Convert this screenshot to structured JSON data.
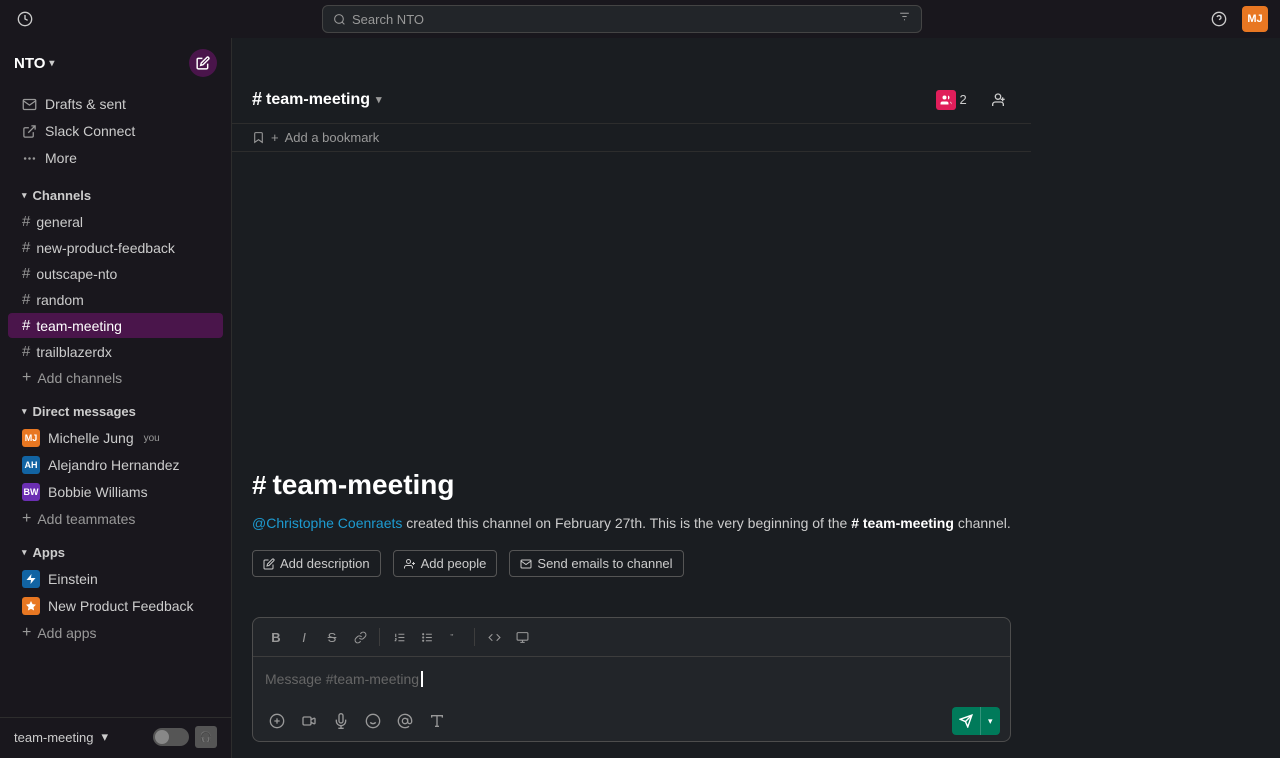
{
  "workspace": {
    "name": "NTO",
    "chevron": "▾"
  },
  "topbar": {
    "search_placeholder": "Search NTO",
    "filter_icon": "⚙",
    "history_icon": "🕐",
    "help_icon": "?",
    "avatar_initials": "MJ"
  },
  "sidebar": {
    "nav_items": [
      {
        "label": "Drafts & sent",
        "icon": "✉"
      },
      {
        "label": "Slack Connect",
        "icon": "⚡"
      },
      {
        "label": "More",
        "icon": "•••"
      }
    ],
    "channels_section": {
      "label": "Channels",
      "items": [
        {
          "label": "general",
          "active": false
        },
        {
          "label": "new-product-feedback",
          "active": false
        },
        {
          "label": "outscape-nto",
          "active": false
        },
        {
          "label": "random",
          "active": false
        },
        {
          "label": "team-meeting",
          "active": true
        },
        {
          "label": "trailblazerdx",
          "active": false
        }
      ],
      "add_label": "Add channels"
    },
    "dm_section": {
      "label": "Direct messages",
      "items": [
        {
          "label": "Michelle Jung",
          "badge": "you",
          "color": "orange"
        },
        {
          "label": "Alejandro Hernandez",
          "badge": "",
          "color": "blue"
        },
        {
          "label": "Bobbie Williams",
          "badge": "",
          "color": "purple"
        }
      ],
      "add_label": "Add teammates"
    },
    "apps_section": {
      "label": "Apps",
      "items": [
        {
          "label": "Einstein",
          "icon": "⚡",
          "color": "#1264a3"
        },
        {
          "label": "New Product Feedback",
          "icon": "★",
          "color": "#e87722"
        }
      ],
      "add_label": "Add apps"
    },
    "footer": {
      "channel_name": "team-meeting",
      "chevron": "▾"
    }
  },
  "channel": {
    "name": "team-meeting",
    "member_count": "2",
    "bookmark_label": "Add a bookmark",
    "intro_title": "# team-meeting",
    "intro_hash": "#",
    "intro_desc_mention": "@Christophe Coenraets",
    "intro_desc_text": " created this channel on February 27th. This is the very beginning of the ",
    "intro_desc_channel": "# team-meeting",
    "intro_desc_end": " channel.",
    "action_add_description": "Add description",
    "action_add_people": "Add people",
    "action_send_emails": "Send emails to channel",
    "message_placeholder": "Message #team-meeting"
  },
  "toolbar": {
    "bold": "B",
    "italic": "I",
    "strike": "S",
    "link": "🔗",
    "ordered_list": "1.",
    "unordered_list": "•",
    "blockquote": "❝",
    "code": "<>",
    "code_block": "⊞"
  }
}
